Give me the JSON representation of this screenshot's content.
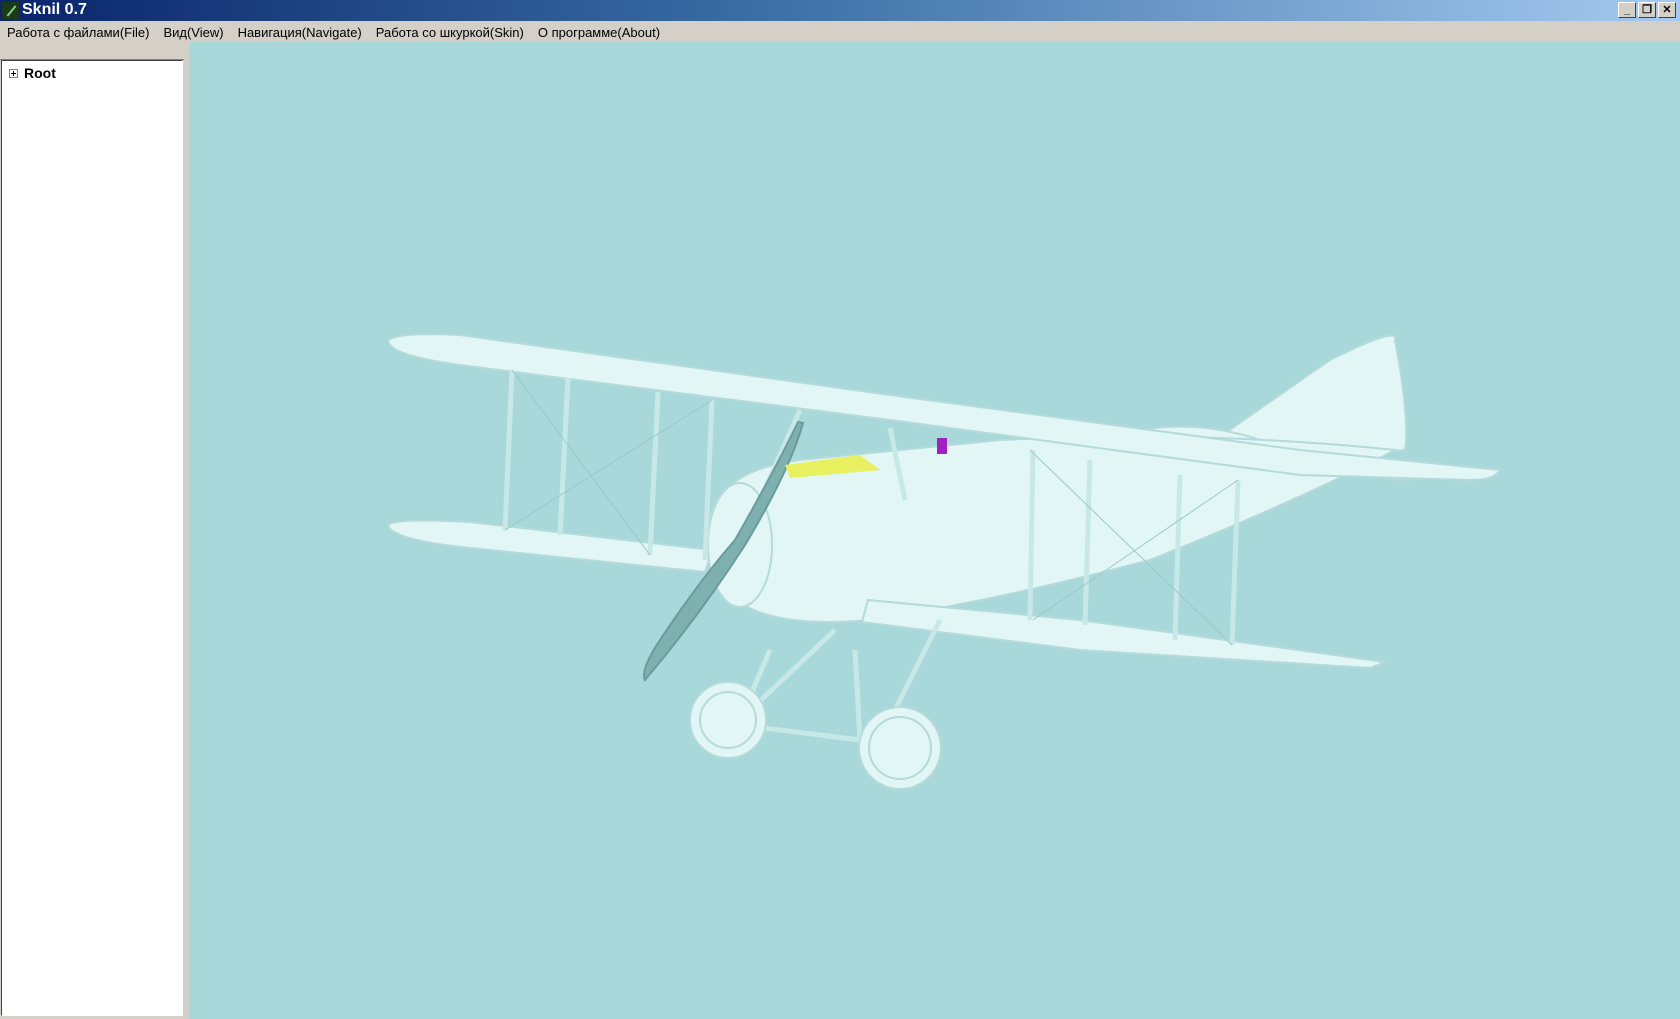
{
  "window": {
    "title": "Sknil 0.7",
    "buttons": {
      "minimize": "_",
      "restore": "❐",
      "close": "✕"
    }
  },
  "menu": [
    {
      "label": "Работа с файлами(File)"
    },
    {
      "label": "Вид(View)"
    },
    {
      "label": "Навигация(Navigate)"
    },
    {
      "label": "Работа со шкуркой(Skin)"
    },
    {
      "label": "О программе(About)"
    }
  ],
  "tree": {
    "root_label": "Root"
  },
  "viewport": {
    "background": "#a9d8da",
    "model_color": "#e2f6f6"
  }
}
